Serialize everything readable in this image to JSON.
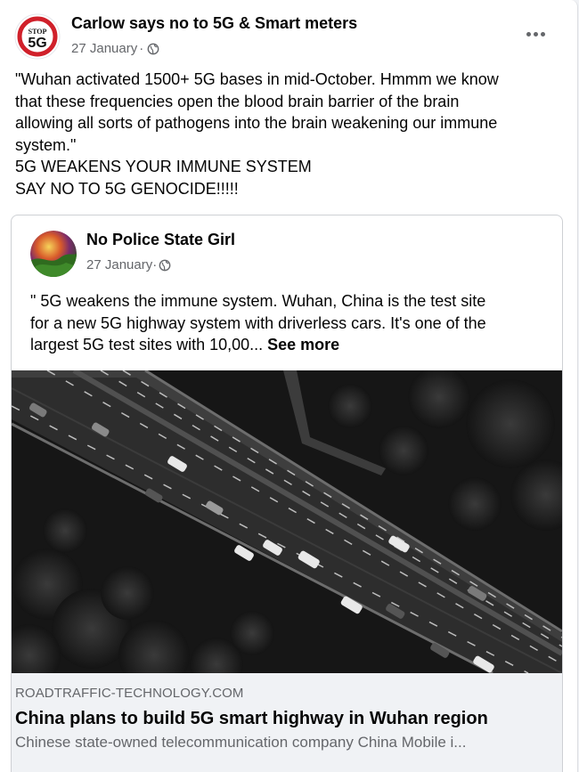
{
  "post": {
    "page_name": "Carlow says no to 5G & Smart meters",
    "avatar_text_top": "STOP",
    "avatar_text_main": "5G",
    "date": "27 January",
    "separator": "·",
    "privacy_icon": "globe-icon",
    "more_icon": "more-horizontal-icon",
    "text_lines": [
      "\"Wuhan activated 1500+ 5G bases in mid-October. Hmmm we know",
      "that these frequencies open the blood brain barrier of the brain",
      "allowing all sorts of pathogens into the brain weakening our immune",
      "system.\"",
      "5G WEAKENS YOUR IMMUNE SYSTEM",
      "SAY NO TO 5G GENOCIDE!!!!!"
    ]
  },
  "shared": {
    "author": "No Police State Girl",
    "date": "27 January",
    "separator": "·",
    "privacy_icon": "globe-icon",
    "text_lines": [
      "\" 5G weakens the immune system. Wuhan, China is the test site",
      "for a new 5G highway system with driverless cars. It's one of the",
      "largest 5G test sites with 10,00..."
    ],
    "see_more": "See more",
    "link": {
      "domain": "ROADTRAFFIC-TECHNOLOGY.COM",
      "title": "China plans to build 5G smart highway in Wuhan region",
      "description": "Chinese state-owned telecommunication company China Mobile i..."
    }
  },
  "colors": {
    "primary_text": "#050505",
    "secondary_text": "#65676b",
    "stop_red": "#d0202a",
    "link_bg": "#f0f2f5"
  }
}
